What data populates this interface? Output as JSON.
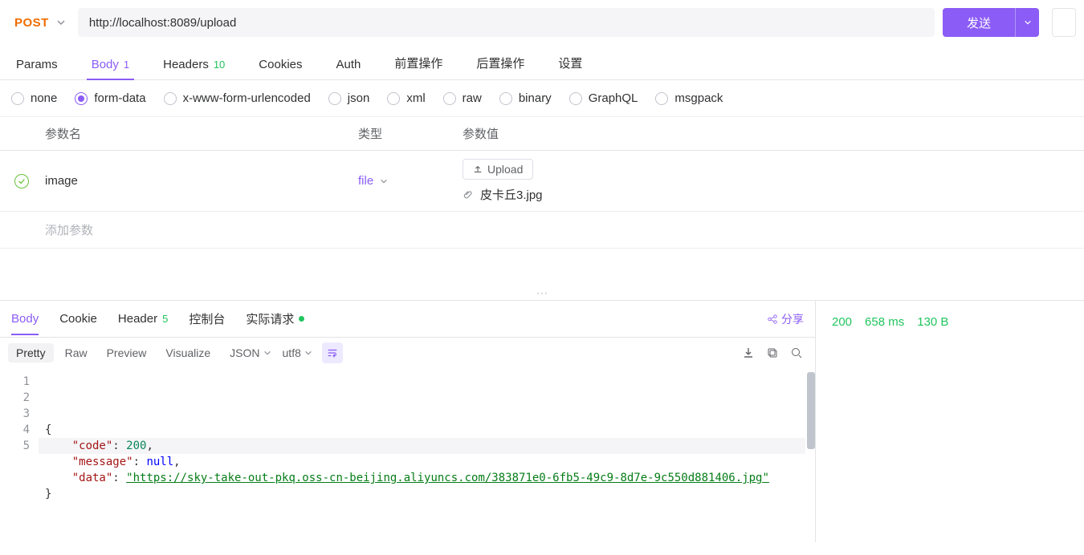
{
  "request": {
    "method": "POST",
    "url": "http://localhost:8089/upload",
    "send_label": "发送"
  },
  "tabs": {
    "params": "Params",
    "body": "Body",
    "body_count": "1",
    "headers": "Headers",
    "headers_count": "10",
    "cookies": "Cookies",
    "auth": "Auth",
    "pre": "前置操作",
    "post": "后置操作",
    "settings": "设置"
  },
  "body_types": {
    "none": "none",
    "form_data": "form-data",
    "urlenc": "x-www-form-urlencoded",
    "json": "json",
    "xml": "xml",
    "raw": "raw",
    "binary": "binary",
    "graphql": "GraphQL",
    "msgpack": "msgpack"
  },
  "table": {
    "h_name": "参数名",
    "h_type": "类型",
    "h_value": "参数值",
    "rows": [
      {
        "name": "image",
        "type": "file",
        "upload_label": "Upload",
        "file": "皮卡丘3.jpg"
      }
    ],
    "add_placeholder": "添加参数"
  },
  "response": {
    "tabs": {
      "body": "Body",
      "cookie": "Cookie",
      "header": "Header",
      "header_count": "5",
      "console": "控制台",
      "actual": "实际请求"
    },
    "share": "分享",
    "view": {
      "pretty": "Pretty",
      "raw": "Raw",
      "preview": "Preview",
      "visualize": "Visualize",
      "format": "JSON",
      "encoding": "utf8"
    },
    "json": {
      "code_key": "\"code\"",
      "code_val": "200",
      "msg_key": "\"message\"",
      "msg_val": "null",
      "data_key": "\"data\"",
      "data_val": "\"https://sky-take-out-pkq.oss-cn-beijing.aliyuncs.com/383871e0-6fb5-49c9-8d7e-9c550d881406.jpg\""
    },
    "status": {
      "code": "200",
      "time": "658 ms",
      "size": "130 B"
    }
  }
}
